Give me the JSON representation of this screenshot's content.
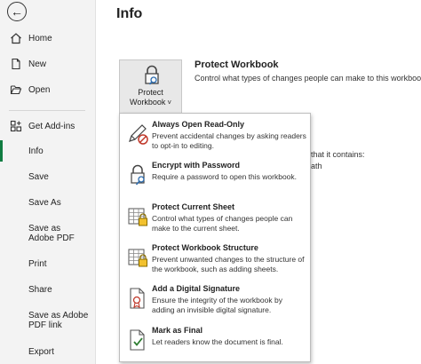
{
  "sidebar": {
    "back_icon": "arrow-left-circle",
    "items": [
      {
        "label": "Home",
        "icon": "home"
      },
      {
        "label": "New",
        "icon": "new-document"
      },
      {
        "label": "Open",
        "icon": "folder-open"
      },
      {
        "label": "Get Add-ins",
        "icon": "grid-add"
      },
      {
        "label": "Info"
      },
      {
        "label": "Save"
      },
      {
        "label": "Save As"
      },
      {
        "label": "Save as Adobe PDF"
      },
      {
        "label": "Print"
      },
      {
        "label": "Share"
      },
      {
        "label": "Save as Adobe PDF link"
      },
      {
        "label": "Export"
      }
    ],
    "active_color": "#107c41"
  },
  "main": {
    "title": "Info",
    "protect_button": {
      "line1": "Protect",
      "line2": "Workbook",
      "chevron": "˅"
    },
    "protect_title": "Protect Workbook",
    "protect_desc": "Control what types of changes people can make to this workbook.",
    "background_fragment1": "that it contains:",
    "background_fragment2": "ath"
  },
  "menu": {
    "items": [
      {
        "title": "Always Open Read-Only",
        "desc": "Prevent accidental changes by asking readers to opt-in to editing.",
        "icon": "pencil-prohibited"
      },
      {
        "title": "Encrypt with Password",
        "desc": "Require a password to open this workbook.",
        "icon": "lock-key"
      },
      {
        "title": "Protect Current Sheet",
        "desc": "Control what types of changes people can make to the current sheet.",
        "icon": "sheet-lock"
      },
      {
        "title": "Protect Workbook Structure",
        "desc": "Prevent unwanted changes to the structure of the workbook, such as adding sheets.",
        "icon": "workbook-structure-lock"
      },
      {
        "title": "Add a Digital Signature",
        "desc": "Ensure the integrity of the workbook by adding an invisible digital signature.",
        "icon": "document-ribbon"
      },
      {
        "title": "Mark as Final",
        "desc": "Let readers know the document is final.",
        "icon": "document-check"
      }
    ]
  }
}
